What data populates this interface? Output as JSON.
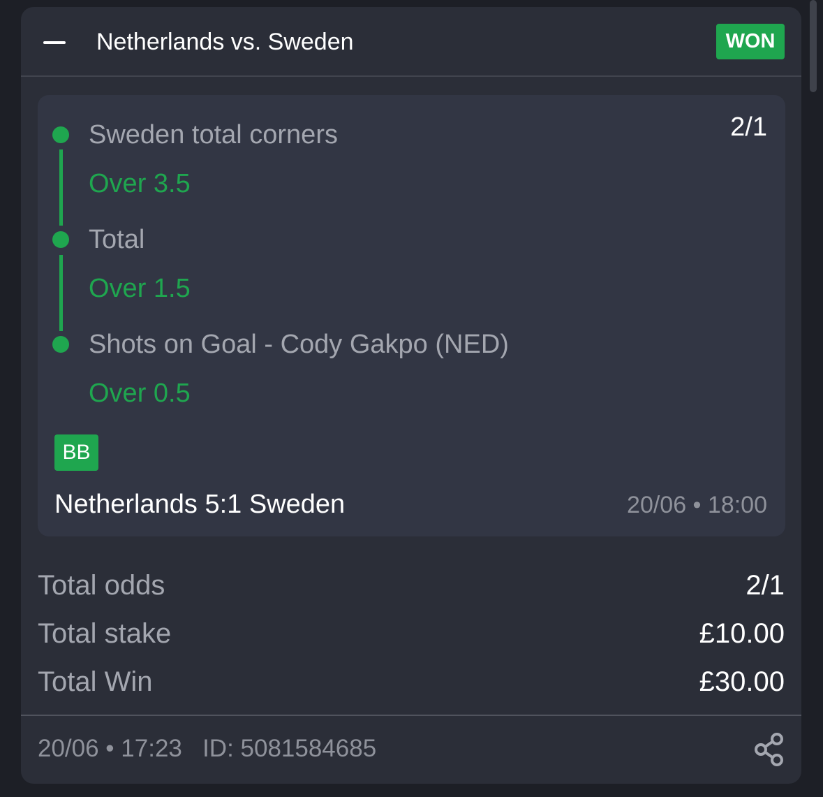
{
  "bet": {
    "title": "Netherlands vs. Sweden",
    "status": "WON",
    "colors": {
      "accent": "#1fa64f",
      "card_bg": "#2b2e38",
      "panel_bg": "#323644",
      "muted_text": "#a4a7b0"
    }
  },
  "selections": [
    {
      "market": "Sweden total corners",
      "outcome": "Over 3.5"
    },
    {
      "market": "Total",
      "outcome": "Over 1.5"
    },
    {
      "market": "Shots on Goal - Cody Gakpo (NED)",
      "outcome": "Over 0.5"
    }
  ],
  "leg_odds": "2/1",
  "badge": "BB",
  "match": {
    "result": "Netherlands 5:1 Sweden",
    "datetime": "20/06 • 18:00"
  },
  "summary": {
    "total_odds_label": "Total odds",
    "total_odds_value": "2/1",
    "total_stake_label": "Total stake",
    "total_stake_value": "£10.00",
    "total_win_label": "Total Win",
    "total_win_value": "£30.00"
  },
  "footer": {
    "placed_at": "20/06 • 17:23",
    "id_text": "ID: 5081584685",
    "share_icon": "share-icon"
  }
}
